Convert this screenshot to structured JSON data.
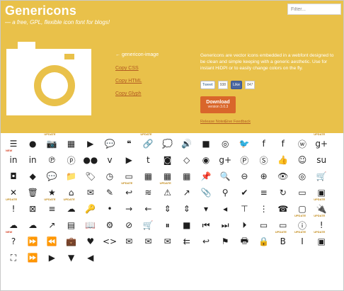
{
  "header": {
    "title": "Genericons",
    "tagline": "— a free, GPL, flexible icon font for blogs!"
  },
  "filter": {
    "placeholder": "Filter..."
  },
  "preview": {
    "image_label": "← genericon-image",
    "links": [
      "Copy CSS",
      "Copy HTML",
      "Copy Glyph"
    ]
  },
  "about": {
    "description": "Genericons are vector icons embedded in a webfont designed to\nbe clean and simple keeping with a generic aesthetic. Use for\ninstant HiDPI or to easily change colors on the fly.",
    "social": {
      "tweet": "Tweet",
      "tweet_count": "938",
      "like": "Like",
      "like_count": "847"
    },
    "download_label": "Download",
    "download_version": "version 3.0.3",
    "release_notes": "Release Notes",
    "feedback": "Give Feedback"
  },
  "colors": {
    "hero_bg": "#e9c14a",
    "download_bg": "#d9662b",
    "link": "#b25a22"
  },
  "icon_tags": {
    "new": "NEW",
    "update": "UPDATE"
  },
  "icon_grid": [
    [
      "standard-icon",
      "aside-icon",
      "image-icon",
      "gallery-icon",
      "video-icon",
      "status-icon",
      "quote-icon",
      "link-icon",
      "chat-icon",
      "audio-icon",
      "github-icon",
      "dribbble-icon",
      "twitter-icon",
      "facebook-icon",
      "facebook-alt-icon",
      "wordpress-icon",
      "googleplus-icon"
    ],
    [
      "linkedin-icon",
      "linkedin-alt-icon",
      "pinterest-icon",
      "pinterest-alt-icon",
      "flickr-icon",
      "vimeo-icon",
      "youtube-icon",
      "tumblr-icon",
      "instagram-icon",
      "codepen-icon",
      "polldaddy-icon",
      "googleplus-alt-icon",
      "path-icon",
      "skype-icon",
      "digg-icon",
      "reddit-icon",
      "stumbleupon-icon"
    ],
    [
      "pocket-icon",
      "dropbox-icon",
      "comment-icon",
      "category-icon",
      "tag-icon",
      "time-icon",
      "edit-icon",
      "day-icon",
      "week-icon",
      "month-icon",
      "pinned-icon",
      "search-icon",
      "zoom-out-icon",
      "zoom-icon",
      "show-icon",
      "hide-icon",
      "cart-icon"
    ],
    [
      "close-alt-icon",
      "trash-icon",
      "star-icon",
      "home-icon",
      "mail-icon",
      "edit-pencil-icon",
      "reply-icon",
      "feed-icon",
      "warning-icon",
      "share-icon",
      "attachment-icon",
      "location-icon",
      "checkmark-icon",
      "menu-icon",
      "refresh-icon",
      "minimize-icon",
      "maximize-icon"
    ],
    [
      "404-icon",
      "spam-icon",
      "summary-icon",
      "cloud-icon",
      "key-icon",
      "dot-icon",
      "next-icon",
      "previous-icon",
      "expand-icon",
      "collapse-icon",
      "dropdown-icon",
      "dropdown-left-icon",
      "top-icon",
      "draggable-icon",
      "phone-icon",
      "send-to-phone-icon",
      "plugin-icon"
    ],
    [
      "cloud-download-icon",
      "cloud-upload-icon",
      "external-icon",
      "document-icon",
      "book-icon",
      "cog-icon",
      "unapprove-icon",
      "cart-alt-icon",
      "pause-icon",
      "stop-icon",
      "skip-back-icon",
      "skip-ahead-icon",
      "play-icon",
      "tablet-icon",
      "send-to-tablet-icon",
      "info-icon",
      "notice-icon"
    ],
    [
      "help-icon",
      "fastforward-icon",
      "rewind-icon",
      "portfolio-icon",
      "heart-icon",
      "code-icon",
      "subscribe-icon",
      "unsubscribe-icon",
      "subscribed-icon",
      "reply-alt-icon",
      "reply-single-icon",
      "flag-icon",
      "print-icon",
      "lock-icon",
      "bold-icon",
      "italic-icon",
      "picture-icon"
    ],
    [
      "fullscreen-icon",
      "fastforward-alt-icon",
      "play-small-icon",
      "dropdown-small-icon",
      "previous-small-icon"
    ]
  ],
  "glyphs": [
    [
      "☰",
      "●",
      "📷",
      "▦",
      "▶",
      "💬",
      "❝",
      "🔗",
      "💭",
      "🔊",
      "",
      "◎",
      "🐦",
      "f",
      "f",
      "ⓦ",
      "g+"
    ],
    [
      "in",
      "in",
      "℗",
      "ⓟ",
      "●●",
      "v",
      "▶",
      "t",
      "◙",
      "◇",
      "◉",
      "g+",
      "Ⓟ",
      "Ⓢ",
      "👍",
      "☺",
      "su"
    ],
    [
      "◘",
      "◆",
      "💬",
      "📁",
      "🏷",
      "◷",
      "▭",
      "▦",
      "▦",
      "▦",
      "📌",
      "🔍",
      "⊖",
      "⊕",
      "👁",
      "◎",
      "🛒"
    ],
    [
      "✕",
      "🗑",
      "★",
      "⌂",
      "✉",
      "✎",
      "↩",
      "≋",
      "⚠",
      "↗",
      "📎",
      "⚲",
      "✔",
      "≡",
      "↻",
      "▭",
      "▣"
    ],
    [
      "!",
      "⊠",
      "≡",
      "☁",
      "🔑",
      "•",
      "→",
      "←",
      "⇕",
      "⇕",
      "▾",
      "◂",
      "⊤",
      "⋮",
      "☎",
      "▢",
      "🔌"
    ],
    [
      "☁",
      "☁",
      "↗",
      "▤",
      "📖",
      "⚙",
      "⊘",
      "🛒",
      "⏸",
      "■",
      "⏮",
      "⏭",
      "⏵",
      "▭",
      "▭",
      "ⓘ",
      "!"
    ],
    [
      "?",
      "⏩",
      "⏪",
      "💼",
      "♥",
      "<>",
      "✉",
      "✉",
      "✉",
      "⇇",
      "↩",
      "⚑",
      "🖶",
      "🔒",
      "B",
      "I",
      "▣"
    ],
    [
      "⛶",
      "⏩",
      "▶",
      "▼",
      "◀"
    ]
  ],
  "badges": [
    {
      "row": 0,
      "col": 2,
      "type": "update"
    },
    {
      "row": 0,
      "col": 7,
      "type": "update"
    },
    {
      "row": 0,
      "col": 16,
      "type": "update"
    },
    {
      "row": 1,
      "col": 0,
      "type": "new"
    },
    {
      "row": 3,
      "col": 6,
      "type": "update"
    },
    {
      "row": 3,
      "col": 8,
      "type": "update"
    },
    {
      "row": 4,
      "col": 0,
      "type": "update"
    },
    {
      "row": 4,
      "col": 2,
      "type": "update"
    },
    {
      "row": 4,
      "col": 3,
      "type": "update"
    },
    {
      "row": 4,
      "col": 16,
      "type": "update"
    },
    {
      "row": 5,
      "col": 15,
      "type": "update"
    },
    {
      "row": 5,
      "col": 16,
      "type": "update"
    },
    {
      "row": 6,
      "col": 0,
      "type": "new"
    },
    {
      "row": 6,
      "col": 14,
      "type": "update"
    },
    {
      "row": 6,
      "col": 15,
      "type": "update"
    },
    {
      "row": 6,
      "col": 16,
      "type": "update"
    }
  ]
}
